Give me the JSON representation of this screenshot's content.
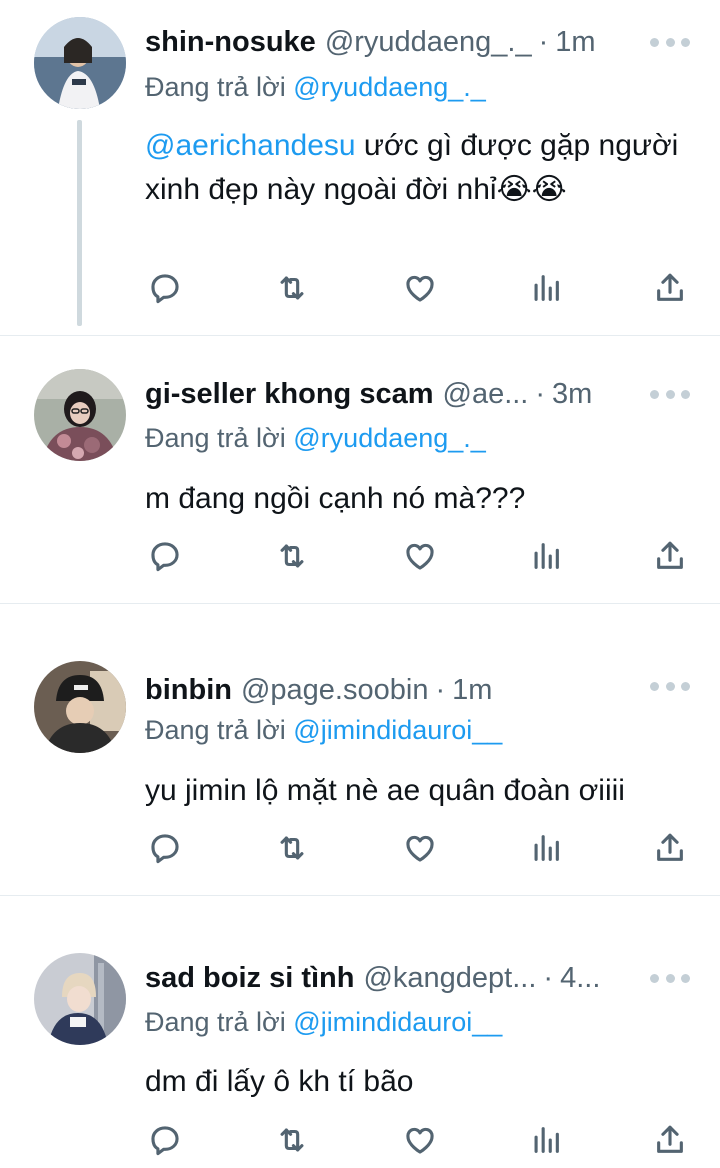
{
  "tweets": [
    {
      "name": "shin-nosuke",
      "handle": "@ryuddaeng_._",
      "dot": "·",
      "time": "1m",
      "reply_prefix": "Đang trả lời",
      "reply_to": "@ryuddaeng_._",
      "mention": "@aerichandesu",
      "text": " ước gì được gặp người xinh đẹp này ngoài đời nhỉ😭😭",
      "avatar_colors": [
        "#8aa2bb",
        "#3d4a5a",
        "#dfe6ee"
      ]
    },
    {
      "name": "gi-seller khong scam",
      "handle": "@ae...",
      "dot": "·",
      "time": "3m",
      "reply_prefix": "Đang trả lời",
      "reply_to": "@ryuddaeng_._",
      "mention": "",
      "text": "m đang ngồi cạnh nó mà???",
      "avatar_colors": [
        "#7a4e5a",
        "#c8a6ae",
        "#2e2428"
      ]
    },
    {
      "name": "binbin",
      "handle": "@page.soobin",
      "dot": "·",
      "time": "1m",
      "reply_prefix": "Đang trả lời",
      "reply_to": "@jimindidauroi__",
      "mention": "",
      "text": "yu jimin lộ mặt nè ae quân đoàn ơiiii",
      "avatar_colors": [
        "#2a2a2a",
        "#8c7a66",
        "#d9c9b4"
      ]
    },
    {
      "name": "sad boiz si tình",
      "handle": "@kangdept...",
      "dot": "·",
      "time": "4...",
      "reply_prefix": "Đang trả lời",
      "reply_to": "@jimindidauroi__",
      "mention": "",
      "text": "dm đi lấy ô kh tí bão",
      "avatar_colors": [
        "#b8bcc4",
        "#2f3a5a",
        "#f0e4d8"
      ]
    }
  ],
  "actions": {
    "reply_icon": "reply-icon",
    "retweet_icon": "retweet-icon",
    "like_icon": "like-icon",
    "views_icon": "views-icon",
    "share_icon": "share-icon"
  },
  "colors": {
    "link": "#1d9bf0",
    "secondary_text": "#536471",
    "primary_text": "#0f1419",
    "divider": "#e6ecf0"
  }
}
